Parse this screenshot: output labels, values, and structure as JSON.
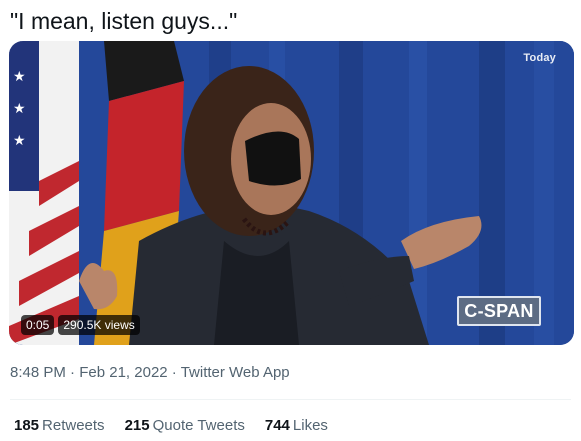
{
  "tweet": {
    "text": "\"I mean, listen guys...\""
  },
  "media": {
    "today_label": "Today",
    "network_logo": "C-SPAN",
    "elapsed": "0:05",
    "views": "290.5K views"
  },
  "meta": {
    "time": "8:48 PM",
    "date": "Feb 21, 2022",
    "source": "Twitter Web App",
    "separator": "·"
  },
  "stats": {
    "retweets_count": "185",
    "retweets_label": "Retweets",
    "quotes_count": "215",
    "quotes_label": "Quote Tweets",
    "likes_count": "744",
    "likes_label": "Likes"
  }
}
